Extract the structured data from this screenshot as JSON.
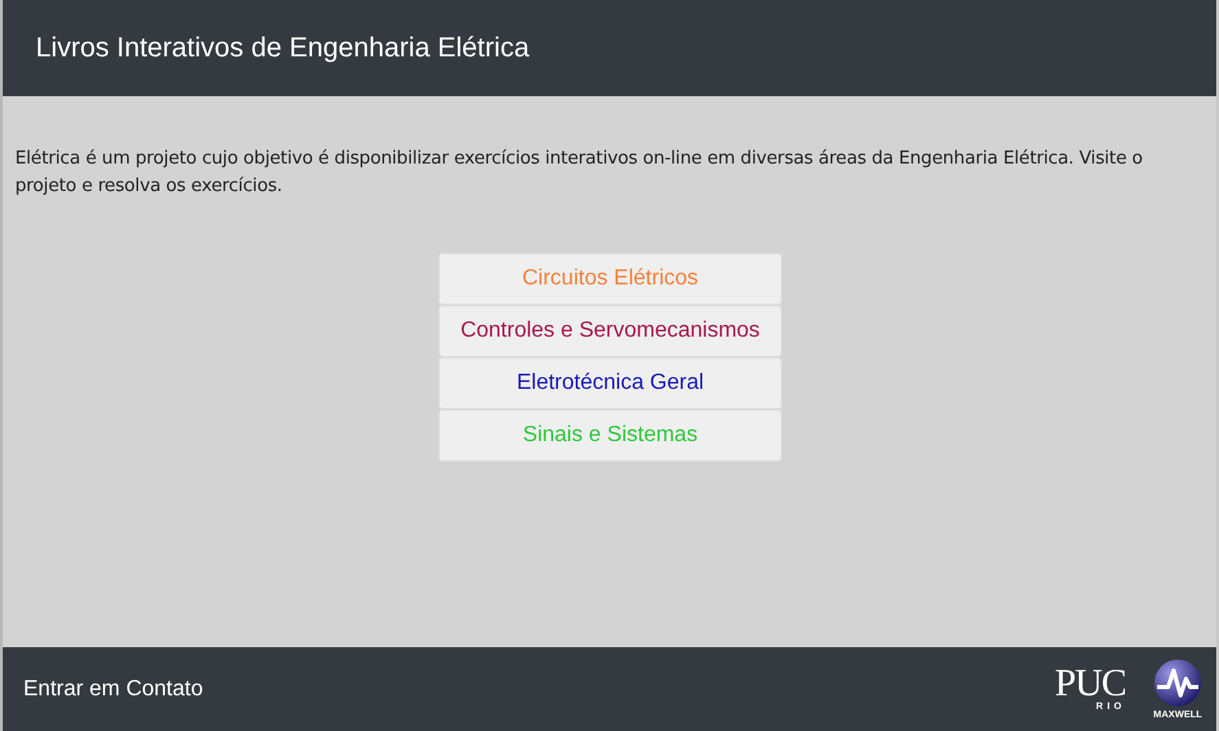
{
  "header": {
    "title": "Livros Interativos de Engenharia Elétrica"
  },
  "intro": "Elétrica é um projeto cujo objetivo é disponibilizar exercícios interativos on-line em diversas áreas da Engenharia Elétrica. Visite o projeto e resolva os exercícios.",
  "books": [
    {
      "label": "Circuitos Elétricos",
      "color": "#f4823c"
    },
    {
      "label": "Controles e Servomecanismos",
      "color": "#a8184c"
    },
    {
      "label": "Eletrotécnica Geral",
      "color": "#1a1ab8"
    },
    {
      "label": "Sinais e Sistemas",
      "color": "#2ec83c"
    }
  ],
  "footer": {
    "contact": "Entrar em Contato",
    "logos": [
      {
        "kind": "puc",
        "name": "PUC",
        "sub": "RIO"
      },
      {
        "kind": "maxwell",
        "name": "MAXWELL"
      }
    ]
  }
}
